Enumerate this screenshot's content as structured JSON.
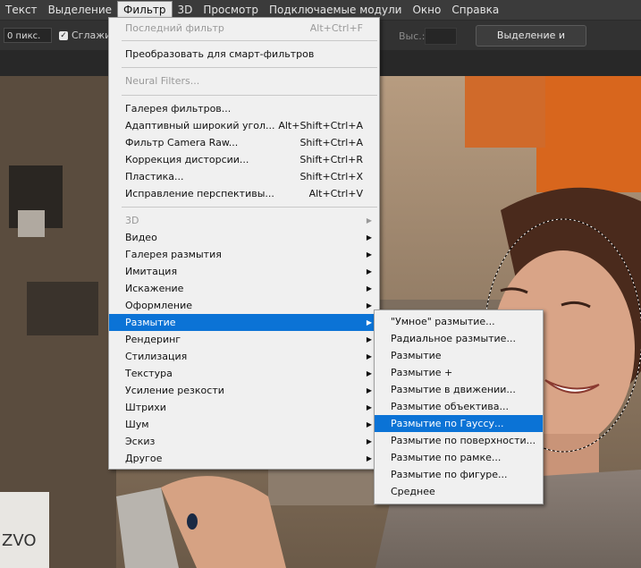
{
  "menubar": {
    "items": [
      "Текст",
      "Выделение",
      "Фильтр",
      "3D",
      "Просмотр",
      "Подключаемые модули",
      "Окно",
      "Справка"
    ],
    "active_index": 2
  },
  "options": {
    "feather_value": "0 пикс.",
    "antialias_label": "Сглажив",
    "antialias_checked": true,
    "height_label": "Выс.:",
    "select_mask_button": "Выделение и маска..."
  },
  "filter_menu": {
    "last_filter": {
      "label": "Последний фильтр",
      "shortcut": "Alt+Ctrl+F"
    },
    "smart": {
      "label": "Преобразовать для смарт-фильтров"
    },
    "neural": {
      "label": "Neural Filters..."
    },
    "group1": [
      {
        "label": "Галерея фильтров...",
        "shortcut": ""
      },
      {
        "label": "Адаптивный широкий угол...",
        "shortcut": "Alt+Shift+Ctrl+A"
      },
      {
        "label": "Фильтр Camera Raw...",
        "shortcut": "Shift+Ctrl+A"
      },
      {
        "label": "Коррекция дисторсии...",
        "shortcut": "Shift+Ctrl+R"
      },
      {
        "label": "Пластика...",
        "shortcut": "Shift+Ctrl+X"
      },
      {
        "label": "Исправление перспективы...",
        "shortcut": "Alt+Ctrl+V"
      }
    ],
    "group2": [
      {
        "label": "3D"
      },
      {
        "label": "Видео"
      },
      {
        "label": "Галерея размытия"
      },
      {
        "label": "Имитация"
      },
      {
        "label": "Искажение"
      },
      {
        "label": "Оформление"
      },
      {
        "label": "Размытие"
      },
      {
        "label": "Рендеринг"
      },
      {
        "label": "Стилизация"
      },
      {
        "label": "Текстура"
      },
      {
        "label": "Усиление резкости"
      },
      {
        "label": "Штрихи"
      },
      {
        "label": "Шум"
      },
      {
        "label": "Эскиз"
      },
      {
        "label": "Другое"
      }
    ]
  },
  "blur_submenu": {
    "items": [
      "\"Умное\" размытие...",
      "Радиальное размытие...",
      "Размытие",
      "Размытие +",
      "Размытие в движении...",
      "Размытие объектива...",
      "Размытие по Гауссу...",
      "Размытие по поверхности...",
      "Размытие по рамке...",
      "Размытие по фигуре...",
      "Среднее"
    ],
    "highlighted_index": 6
  },
  "photo": {
    "cup_text": "ZVO",
    "colors": {
      "wall": "#d8661d",
      "highlight": "#0b73d6"
    }
  }
}
